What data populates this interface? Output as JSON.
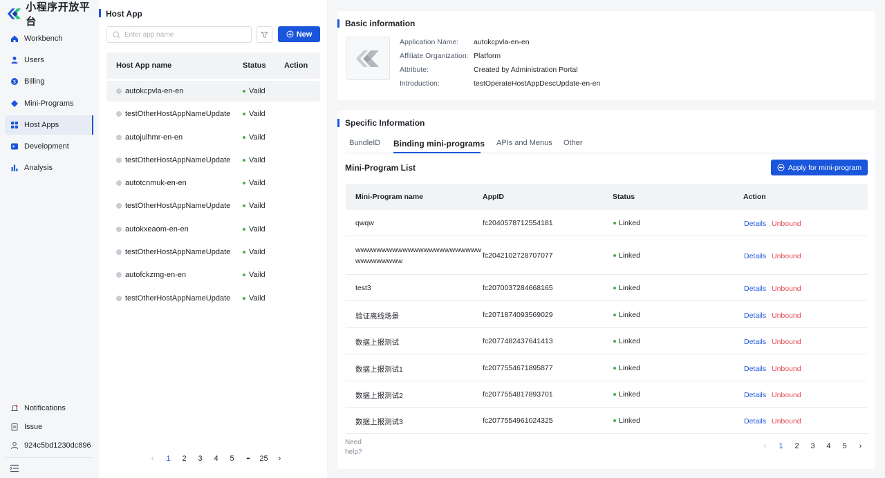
{
  "brand": {
    "name": "小程序开放平台"
  },
  "sidebar": {
    "items": [
      {
        "label": "Workbench",
        "icon": "home-icon"
      },
      {
        "label": "Users",
        "icon": "user-icon"
      },
      {
        "label": "Billing",
        "icon": "billing-icon"
      },
      {
        "label": "Mini-Programs",
        "icon": "diamond-icon"
      },
      {
        "label": "Host Apps",
        "icon": "grid-icon",
        "active": true
      },
      {
        "label": "Development",
        "icon": "terminal-icon"
      },
      {
        "label": "Analysis",
        "icon": "bar-chart-icon"
      }
    ],
    "bottom": [
      {
        "label": "Notifications",
        "icon": "bell-icon"
      },
      {
        "label": "Issue",
        "icon": "clipboard-icon"
      },
      {
        "label": "924c5bd1230dc896",
        "icon": "user-outline-icon"
      }
    ]
  },
  "host_panel": {
    "title": "Host App",
    "search_placeholder": "Enter app name",
    "new_label": "New",
    "columns": [
      "Host App name",
      "Status",
      "Action"
    ],
    "rows": [
      {
        "name": "autokcpvla-en-en",
        "status": "Vaild"
      },
      {
        "name": "testOtherHostAppNameUpdate",
        "status": "Vaild"
      },
      {
        "name": "autojulhmr-en-en",
        "status": "Vaild"
      },
      {
        "name": "testOtherHostAppNameUpdate",
        "status": "Vaild"
      },
      {
        "name": "autotcnmuk-en-en",
        "status": "Vaild"
      },
      {
        "name": "testOtherHostAppNameUpdate",
        "status": "Vaild"
      },
      {
        "name": "autokxeaom-en-en",
        "status": "Vaild"
      },
      {
        "name": "testOtherHostAppNameUpdate",
        "status": "Vaild"
      },
      {
        "name": "autofckzmg-en-en",
        "status": "Vaild"
      },
      {
        "name": "testOtherHostAppNameUpdate",
        "status": "Vaild"
      }
    ],
    "pager": {
      "prev": "‹",
      "pages": [
        "1",
        "2",
        "3",
        "4",
        "5"
      ],
      "ellipsis": "•••",
      "last": "25",
      "next": "›",
      "current": "1"
    }
  },
  "basic": {
    "title": "Basic information",
    "fields": [
      {
        "label": "Application Name:",
        "value": "autokcpvla-en-en"
      },
      {
        "label": "Affiliate Organization:",
        "value": "Platform"
      },
      {
        "label": "Attribute:",
        "value": "Created by Administration Portal"
      },
      {
        "label": "Introduction:",
        "value": "testOperateHostAppDescUpdate-en-en"
      }
    ]
  },
  "specific": {
    "title": "Specific Information",
    "tabs": [
      "BundleID",
      "Binding mini-programs",
      "APIs and Menus",
      "Other"
    ],
    "active_tab": "Binding mini-programs",
    "list_title": "Mini-Program List",
    "apply_label": "Apply for mini-program",
    "columns": [
      "Mini-Program name",
      "AppID",
      "Status",
      "Action"
    ],
    "rows": [
      {
        "name": "qwqw",
        "name2": "",
        "appid": "fc2040578712554181",
        "status": "Linked",
        "details": "Details",
        "unbound": "Unbound"
      },
      {
        "name": "wwwwwwwwwwwwwwwwwwwwwwww",
        "name2": "wwwwwwwww",
        "appid": "fc2042102728707077",
        "status": "Linked",
        "details": "Details",
        "unbound": "Unbound"
      },
      {
        "name": "test3",
        "name2": "",
        "appid": "fc2070037284668165",
        "status": "Linked",
        "details": "Details",
        "unbound": "Unbound"
      },
      {
        "name": "验证离线场景",
        "name2": "",
        "appid": "fc2071874093569029",
        "status": "Linked",
        "details": "Details",
        "unbound": "Unbound"
      },
      {
        "name": "数据上报测试",
        "name2": "",
        "appid": "fc2077482437641413",
        "status": "Linked",
        "details": "Details",
        "unbound": "Unbound"
      },
      {
        "name": "数据上报测试1",
        "name2": "",
        "appid": "fc2077554671895877",
        "status": "Linked",
        "details": "Details",
        "unbound": "Unbound"
      },
      {
        "name": "数据上报测试2",
        "name2": "",
        "appid": "fc2077554817893701",
        "status": "Linked",
        "details": "Details",
        "unbound": "Unbound"
      },
      {
        "name": "数据上报测试3",
        "name2": "",
        "appid": "fc2077554961024325",
        "status": "Linked",
        "details": "Details",
        "unbound": "Unbound"
      }
    ],
    "need_help_1": "Need",
    "need_help_2": "help?",
    "pager": {
      "prev": "‹",
      "pages": [
        "1",
        "2",
        "3",
        "4",
        "5"
      ],
      "next": "›",
      "current": "1"
    }
  },
  "colors": {
    "accent": "#1a56db",
    "success": "#3fb24a",
    "danger": "#e5484d"
  }
}
